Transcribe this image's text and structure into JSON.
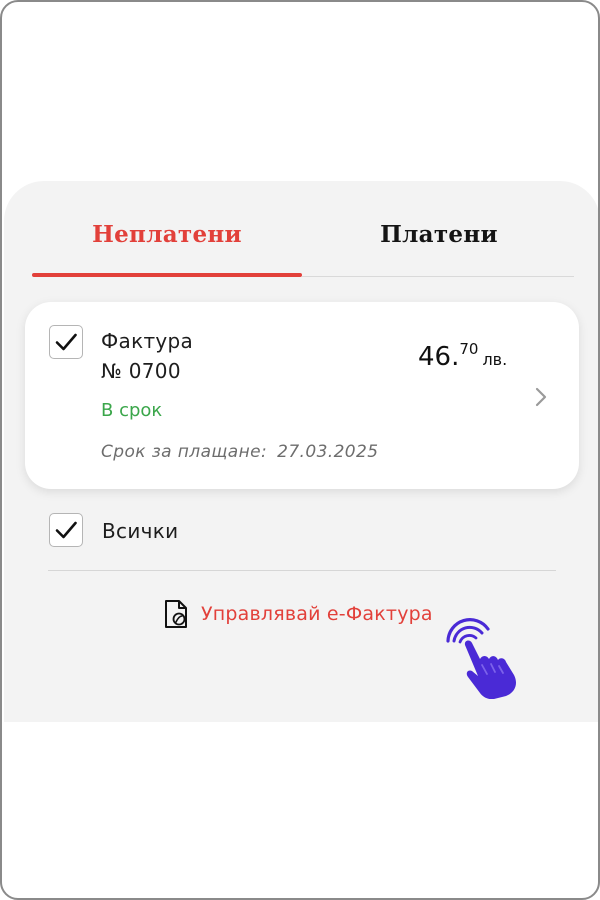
{
  "tabs": {
    "unpaid_label": "Неплатени",
    "paid_label": "Платени",
    "active": "unpaid"
  },
  "invoice": {
    "checked": true,
    "title": "Фактура",
    "number": "№ 0700",
    "status": "В срок",
    "due_label": "Срок за плащане:",
    "due_date": "27.03.2025",
    "amount_int": "46.",
    "amount_dec": "70",
    "currency": "лв."
  },
  "select_all": {
    "checked": true,
    "label": "Всички"
  },
  "manage": {
    "label": "Управлявай е-Фактура"
  },
  "icons": {
    "checkbox": "check-icon",
    "chevron": "chevron-right-icon",
    "document": "e-invoice-document-icon",
    "pointer": "pointing-hand-icon"
  },
  "colors": {
    "accent": "#e2403a",
    "status_ok": "#3aa64a",
    "pointer": "#4a2ad6",
    "sheet_bg": "#f3f3f3"
  }
}
